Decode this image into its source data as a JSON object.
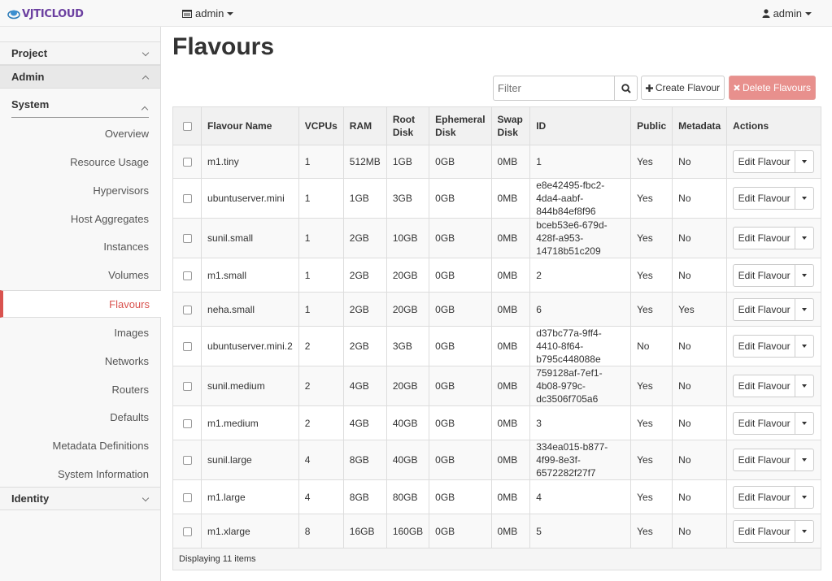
{
  "navbar": {
    "brand_prefix": "VJTI",
    "brand_suffix": "CLOUD",
    "project_menu": "admin",
    "user_menu": "admin"
  },
  "sidebar": {
    "project": "Project",
    "admin": "Admin",
    "system": "System",
    "items": [
      "Overview",
      "Resource Usage",
      "Hypervisors",
      "Host Aggregates",
      "Instances",
      "Volumes",
      "Flavours",
      "Images",
      "Networks",
      "Routers",
      "Defaults",
      "Metadata Definitions",
      "System Information"
    ],
    "active_item": "Flavours",
    "identity": "Identity"
  },
  "page": {
    "title": "Flavours",
    "filter_placeholder": "Filter",
    "create_label": "Create Flavour",
    "delete_label": "Delete Flavours"
  },
  "table": {
    "headers": [
      "Flavour Name",
      "VCPUs",
      "RAM",
      "Root Disk",
      "Ephemeral Disk",
      "Swap Disk",
      "ID",
      "Public",
      "Metadata",
      "Actions"
    ],
    "rows": [
      {
        "name": "m1.tiny",
        "vcpus": "1",
        "ram": "512MB",
        "root": "1GB",
        "eph": "0GB",
        "swap": "0MB",
        "id": "1",
        "public": "Yes",
        "meta": "No"
      },
      {
        "name": "ubuntuserver.mini",
        "vcpus": "1",
        "ram": "1GB",
        "root": "3GB",
        "eph": "0GB",
        "swap": "0MB",
        "id": "e8e42495-fbc2-4da4-aabf-844b84ef8f96",
        "public": "Yes",
        "meta": "No"
      },
      {
        "name": "sunil.small",
        "vcpus": "1",
        "ram": "2GB",
        "root": "10GB",
        "eph": "0GB",
        "swap": "0MB",
        "id": "bceb53e6-679d-428f-a953-14718b51c209",
        "public": "Yes",
        "meta": "No"
      },
      {
        "name": "m1.small",
        "vcpus": "1",
        "ram": "2GB",
        "root": "20GB",
        "eph": "0GB",
        "swap": "0MB",
        "id": "2",
        "public": "Yes",
        "meta": "No"
      },
      {
        "name": "neha.small",
        "vcpus": "1",
        "ram": "2GB",
        "root": "20GB",
        "eph": "0GB",
        "swap": "0MB",
        "id": "6",
        "public": "Yes",
        "meta": "Yes"
      },
      {
        "name": "ubuntuserver.mini.2",
        "vcpus": "2",
        "ram": "2GB",
        "root": "3GB",
        "eph": "0GB",
        "swap": "0MB",
        "id": "d37bc77a-9ff4-4410-8f64-b795c448088e",
        "public": "No",
        "meta": "No"
      },
      {
        "name": "sunil.medium",
        "vcpus": "2",
        "ram": "4GB",
        "root": "20GB",
        "eph": "0GB",
        "swap": "0MB",
        "id": "759128af-7ef1-4b08-979c-dc3506f705a6",
        "public": "Yes",
        "meta": "No"
      },
      {
        "name": "m1.medium",
        "vcpus": "2",
        "ram": "4GB",
        "root": "40GB",
        "eph": "0GB",
        "swap": "0MB",
        "id": "3",
        "public": "Yes",
        "meta": "No"
      },
      {
        "name": "sunil.large",
        "vcpus": "4",
        "ram": "8GB",
        "root": "40GB",
        "eph": "0GB",
        "swap": "0MB",
        "id": "334ea015-b877-4f99-8e3f-6572282f27f7",
        "public": "Yes",
        "meta": "No"
      },
      {
        "name": "m1.large",
        "vcpus": "4",
        "ram": "8GB",
        "root": "80GB",
        "eph": "0GB",
        "swap": "0MB",
        "id": "4",
        "public": "Yes",
        "meta": "No"
      },
      {
        "name": "m1.xlarge",
        "vcpus": "8",
        "ram": "16GB",
        "root": "160GB",
        "eph": "0GB",
        "swap": "0MB",
        "id": "5",
        "public": "Yes",
        "meta": "No"
      }
    ],
    "action_label": "Edit Flavour",
    "footer": "Displaying 11 items"
  },
  "colors": {
    "brand": "#6b3fa0",
    "active": "#d9534f",
    "link": "#428bca",
    "danger": "#e8908d"
  }
}
